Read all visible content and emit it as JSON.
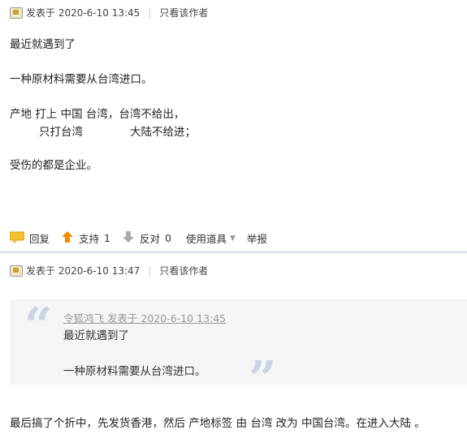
{
  "post1": {
    "meta": {
      "posted_on": "发表于 2020-6-10 13:45",
      "sep": "|",
      "only_author": "只看该作者"
    },
    "lines": [
      "最近就遇到了",
      "一种原材料需要从台湾进口。",
      "产地  打上  中国 台湾，台湾不给出，",
      "只打台湾",
      "大陆不给进；",
      "受伤的都是企业。"
    ],
    "actions": {
      "reply": "回复",
      "support": "支持",
      "support_count": "1",
      "oppose": "反对",
      "oppose_count": "0",
      "tools": "使用道具",
      "report": "举报"
    }
  },
  "post2": {
    "meta": {
      "posted_on": "发表于 2020-6-10 13:47",
      "sep": "|",
      "only_author": "只看该作者"
    },
    "quote": {
      "author": "令狐鸿飞 发表于 2020-6-10 13:45",
      "line1": "最近就遇到了",
      "line2": "一种原材料需要从台湾进口。"
    },
    "body": "最后搞了个折中，先发货香港，然后  产地标签 由 台湾 改为 中国台湾。在进入大陆 。"
  },
  "colors": {
    "accent_orange": "#f08a00",
    "divider": "#d8dee8",
    "quote_bg": "#f5f5f5",
    "quote_mark": "#c8d4e6"
  }
}
